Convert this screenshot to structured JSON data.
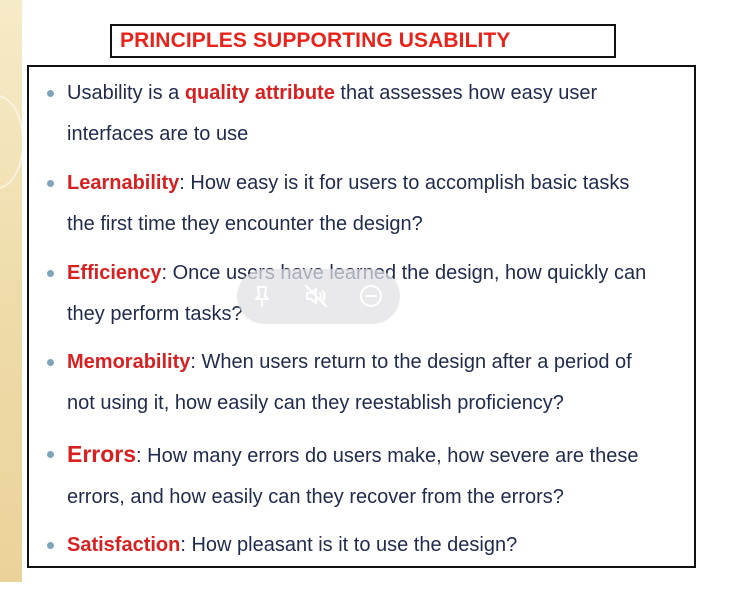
{
  "slide": {
    "title": "PRINCIPLES SUPPORTING USABILITY",
    "bullets": [
      {
        "pre": "Usability is a ",
        "term": "quality attribute",
        "post": " that assesses how easy user",
        "line2": "interfaces are to use"
      },
      {
        "pre": "",
        "term": "Learnability",
        "post": ": How easy is it for users to accomplish basic tasks",
        "line2": "the first time they encounter the design?"
      },
      {
        "pre": "",
        "term": "Efficiency",
        "post": ": Once users have learned the design, how quickly can",
        "line2": "they perform tasks?"
      },
      {
        "pre": "",
        "term": "Memorability",
        "post": ": When users return to the design after a period of",
        "line2": "not using it, how easily can they reestablish proficiency?"
      },
      {
        "pre": "",
        "term": "Errors",
        "post": ": How many errors do users make, how severe are these",
        "line2": "errors, and how easily can they recover from the errors?"
      },
      {
        "pre": "",
        "term": "Satisfaction",
        "post": ": How pleasant is it to use the design?",
        "line2": ""
      }
    ]
  },
  "overlay": {
    "icons": [
      "pin-icon",
      "mute-icon",
      "minimize-icon"
    ]
  },
  "colors": {
    "title_red": "#e8231b",
    "term_red": "#d92020",
    "body_text": "#1f2a4d",
    "bullet": "#7fa3b8"
  }
}
